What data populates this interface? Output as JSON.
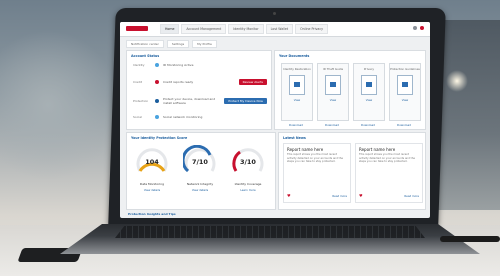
{
  "header": {
    "nav": [
      "Home",
      "Account Management",
      "Identity Monitor",
      "Lost Wallet",
      "Online Privacy"
    ]
  },
  "subnav": [
    "Notification center",
    "Settings",
    "My Profile"
  ],
  "status_panel": {
    "title": "Account Status",
    "rows": [
      {
        "key": "Identity",
        "text": "ID Monitoring Active",
        "dot": "#4aa3df"
      },
      {
        "key": "Credit",
        "text": "Credit reports ready",
        "dot": "#c8102e",
        "button": "Review Alerts"
      },
      {
        "key": "Protection",
        "text": "Protect your device, download and install software",
        "dot": "#1b5e9e",
        "button": "Protect My Device Now"
      },
      {
        "key": "Social",
        "text": "Social network monitoring",
        "dot": "#4aa3df"
      }
    ]
  },
  "docs_panel": {
    "title": "Your Documents",
    "cards": [
      {
        "name": "Identity Restoration",
        "link": "View",
        "under": "Download"
      },
      {
        "name": "ID Theft Guide",
        "link": "View",
        "under": "Download"
      },
      {
        "name": "Privacy",
        "link": "View",
        "under": "Download"
      },
      {
        "name": "Protection Guidelines",
        "link": "View",
        "under": "Download"
      }
    ]
  },
  "score_panel": {
    "title": "Your Identity Protection Score",
    "gauges": [
      {
        "value": "104",
        "label": "Data Monitoring",
        "link": "View details",
        "color": "#e8a317"
      },
      {
        "value": "7/10",
        "label": "Network Integrity",
        "link": "View details",
        "color": "#2b6cb0"
      },
      {
        "value": "3/10",
        "label": "Identity Coverage",
        "link": "Learn more",
        "color": "#c8102e"
      }
    ]
  },
  "news_panel": {
    "title": "Latest News",
    "cards": [
      {
        "title": "Report name here",
        "body": "This report shows you the most recent activity detected on your accounts and the steps you can take to stay protected.",
        "more": "Read more"
      },
      {
        "title": "Report name here",
        "body": "This report shows you the most recent activity detected on your accounts and the steps you can take to stay protected.",
        "more": "Read more"
      }
    ]
  },
  "footer_title": "Protection Insights and Tips"
}
